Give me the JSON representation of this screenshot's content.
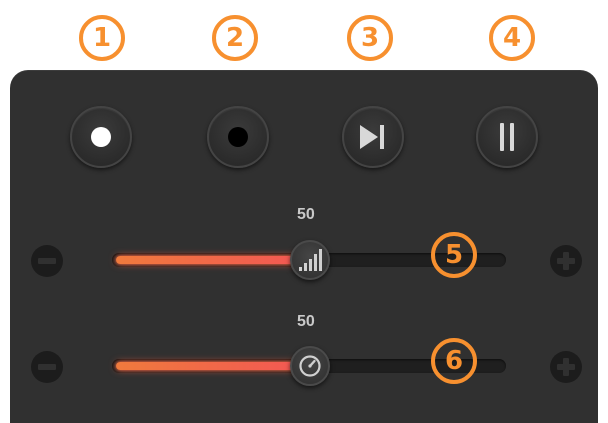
{
  "callouts": {
    "c1": "1",
    "c2": "2",
    "c3": "3",
    "c4": "4",
    "c5": "5",
    "c6": "6"
  },
  "colors": {
    "accent": "#f7902f",
    "panel": "#303030",
    "slider_fill_start": "#f07a3d",
    "slider_fill_end": "#f25555"
  },
  "transport": {
    "buttons": [
      {
        "icon": "white-dot-icon"
      },
      {
        "icon": "black-dot-icon"
      },
      {
        "icon": "skip-forward-icon"
      },
      {
        "icon": "pause-icon"
      }
    ]
  },
  "sliders": {
    "volume": {
      "value_label": "50",
      "value": 50,
      "icon": "signal-bars-icon"
    },
    "speed": {
      "value_label": "50",
      "value": 50,
      "icon": "speedometer-icon"
    }
  }
}
